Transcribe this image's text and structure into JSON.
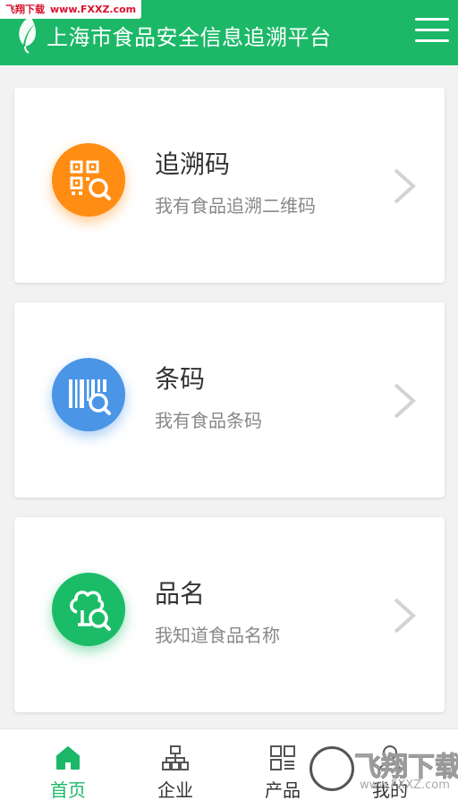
{
  "header": {
    "title": "上海市食品安全信息追溯平台",
    "logo_icon": "leaf-icon",
    "menu_icon": "hamburger-menu-icon"
  },
  "watermark_top": {
    "brand": "飞翔下载",
    "url": "www.FXXZ.com"
  },
  "cards": [
    {
      "title": "追溯码",
      "subtitle": "我有食品追溯二维码",
      "icon": "qr-search-icon",
      "color": "#ff8d14"
    },
    {
      "title": "条码",
      "subtitle": "我有食品条码",
      "icon": "barcode-search-icon",
      "color": "#4a95e6"
    },
    {
      "title": "品名",
      "subtitle": "我知道食品名称",
      "icon": "food-name-search-icon",
      "color": "#1bbc68"
    }
  ],
  "tabs": [
    {
      "label": "首页",
      "icon": "home-icon",
      "active": true
    },
    {
      "label": "企业",
      "icon": "org-chart-icon",
      "active": false
    },
    {
      "label": "产品",
      "icon": "grid-list-icon",
      "active": false
    },
    {
      "label": "我的",
      "icon": "user-icon",
      "active": false
    }
  ],
  "watermark_bottom": {
    "text": "飞翔下载",
    "url": "www.FXXZ.com"
  },
  "colors": {
    "brand_green": "#1cb868",
    "tab_active": "#1cb868",
    "tab_inactive": "#555555"
  }
}
